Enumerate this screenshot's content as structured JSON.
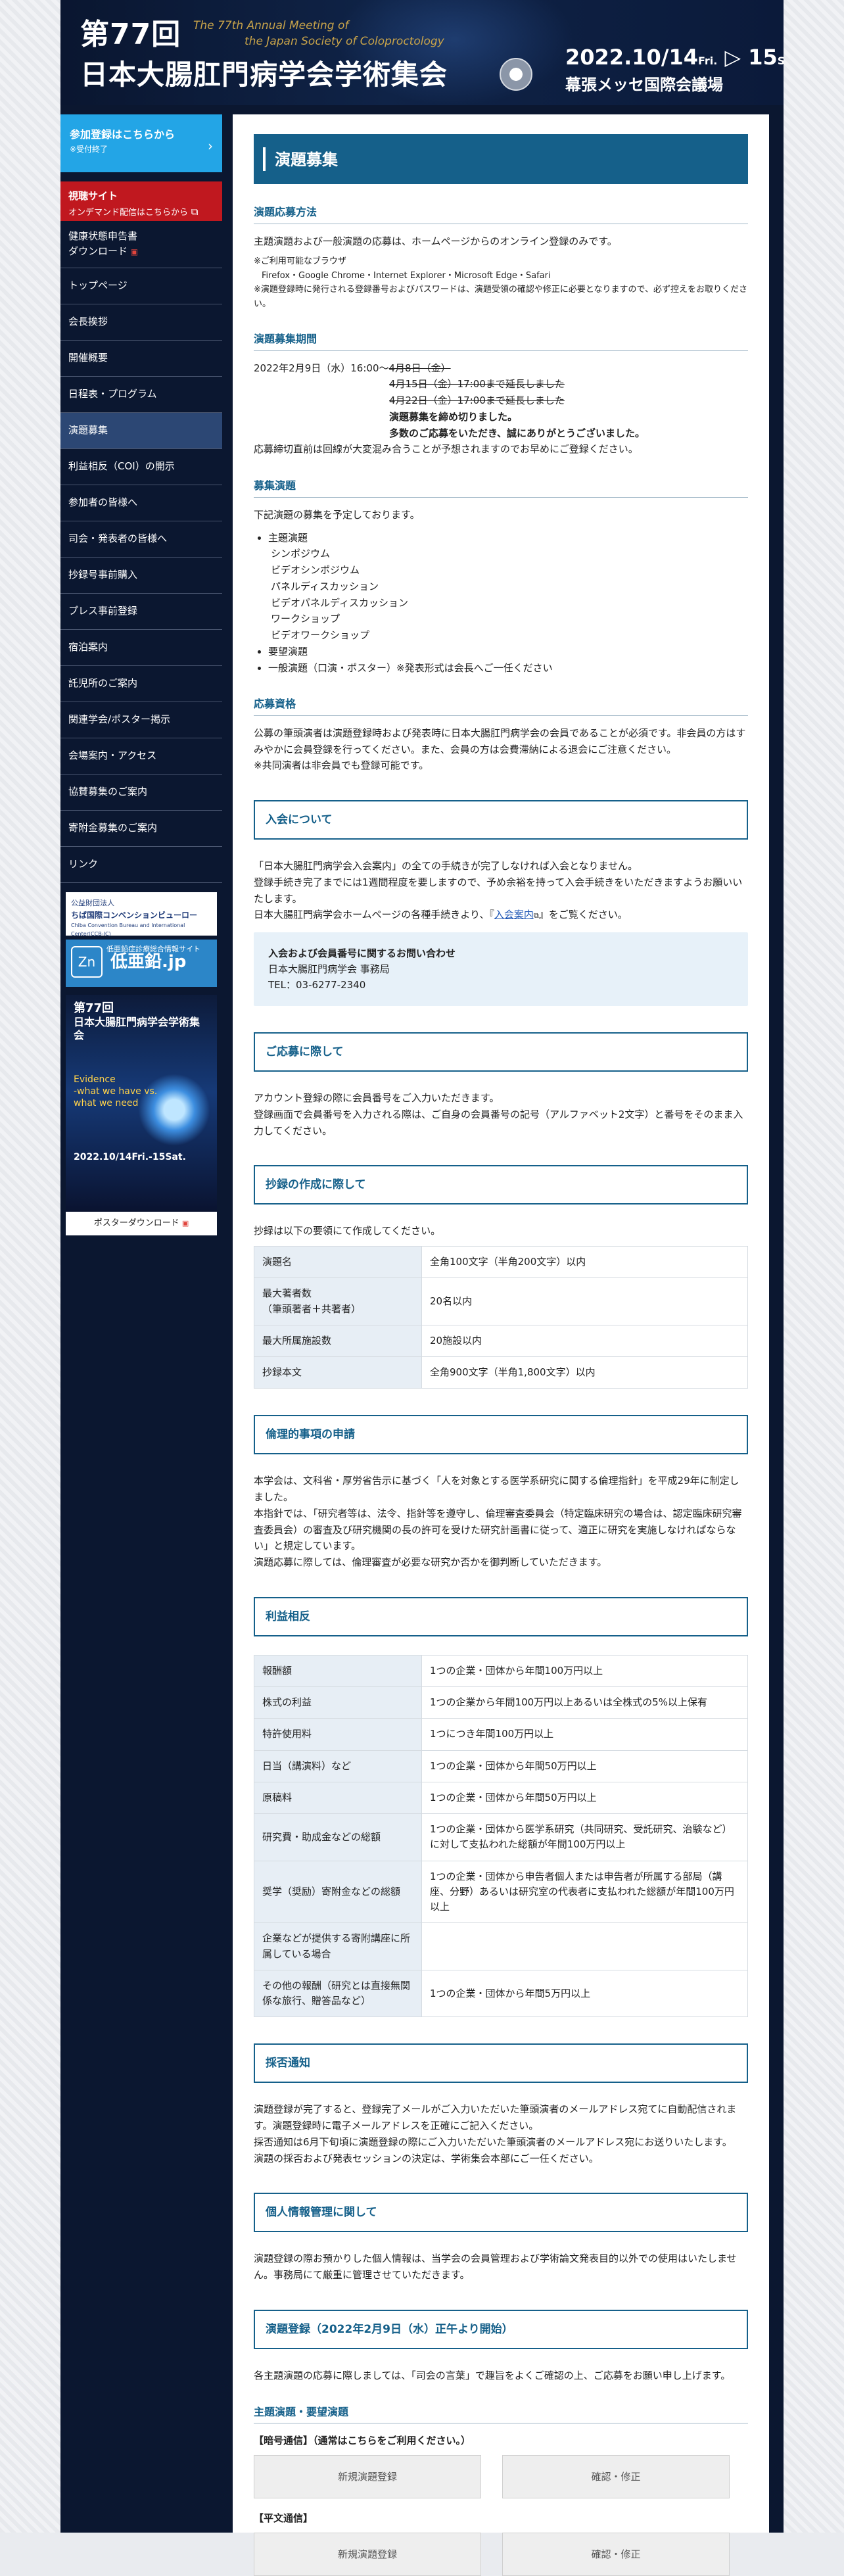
{
  "header": {
    "num": "第77回",
    "title": "日本大腸肛門病学会学術集会",
    "en_line1": "The 77th Annual Meeting of",
    "en_line2": "the Japan Society of Coloproctology",
    "date_main": "2022.10/14",
    "date_fri": "Fri.",
    "date_arrow": "▷",
    "date_15": "15",
    "date_sat": "Sat.",
    "venue": "幕張メッセ国際会議場"
  },
  "sidebar": {
    "register": {
      "title": "参加登録はこちらから",
      "sub": "※受付終了",
      "arrow": "›"
    },
    "live": {
      "title": "視聴サイト",
      "sub": "オンデマンド配信はこちらから",
      "icon": "external-link-icon"
    },
    "items": [
      "健康状態申告書",
      "ダウンロード",
      "トップページ",
      "会長挨拶",
      "開催概要",
      "日程表・プログラム",
      "演題募集",
      "利益相反（COI）の開示",
      "参加者の皆様へ",
      "司会・発表者の皆様へ",
      "抄録号事前購入",
      "プレス事前登録",
      "宿泊案内",
      "託児所のご案内",
      "関連学会/ポスター掲示",
      "会場案内・アクセス",
      "協賛募集のご案内",
      "寄附金募集のご案内",
      "リンク"
    ],
    "banner1": {
      "line1": "公益財団法人",
      "line2": "ちば国際コンベンションビューロー",
      "line3": "Chiba Convention Bureau and International Center(CCB-IC)"
    },
    "banner2": {
      "small": "低亜鉛症診療総合情報サイト",
      "big": "低亜鉛.jp",
      "mark": "Zn"
    },
    "poster": {
      "l1": "第77回",
      "l2": "日本大腸肛門病学会学術集会",
      "l3": "Evidence",
      "l4": "-what we have vs.",
      "l5": "what we need",
      "l6": "2022.10/14Fri.-15Sat."
    },
    "poster_download": "ポスターダウンロード"
  },
  "main": {
    "title": "演題募集",
    "h_apply": "演題応募方法",
    "apply_text": "主題演題および一般演題の応募は、ホームページからのオンライン登録のみです。",
    "browser_head": "※ご利用可能なブラウザ",
    "browser_list": "Firefox・Google Chrome・Internet Explorer・Microsoft Edge・Safari",
    "browser_note": "※演題登録時に発行される登録番号およびパスワードは、演題受領の確認や修正に必要となりますので、必ず控えをお取りください。",
    "h_period": "演題募集期間",
    "period_1": "2022年2月9日（水）16:00～",
    "period_1s": "4月8日（金）",
    "period_2": "4月15日（金）17:00まで延長しました",
    "period_3": "4月22日（金）17:00まで延長しました",
    "period_4": "演題募集を締め切りました。",
    "period_5": "多数のご応募をいただき、誠にありがとうございました。",
    "period_note": "応募締切直前は回線が大変混み合うことが予想されますのでお早めにご登録ください。",
    "h_topics": "募集演題",
    "topics_intro": "下記演題の募集を予定しております。",
    "topic_main": "主題演題",
    "topic_subs": [
      "シンポジウム",
      "ビデオシンポジウム",
      "パネルディスカッション",
      "ビデオパネルディスカッション",
      "ワークショップ",
      "ビデオワークショップ"
    ],
    "topic_req": "要望演題",
    "topic_gen": "一般演題（口演・ポスター）※発表形式は会長へご一任ください",
    "h_qual": "応募資格",
    "qual_text": "公募の筆頭演者は演題登録時および発表時に日本大腸肛門病学会の会員であることが必須です。非会員の方はすみやかに会員登録を行ってください。また、会員の方は会費滞納による退会にご注意ください。",
    "qual_note": "※共同演者は非会員でも登録可能です。",
    "sec_join": "入会について",
    "join_1": "「日本大腸肛門病学会入会案内」の全ての手続きが完了しなければ入会となりません。",
    "join_2": "登録手続き完了までには1週間程度を要しますので、予め余裕を持って入会手続きをいただきますようお願いいたします。",
    "join_3a": "日本大腸肛門病学会ホームページの各種手続きより、『",
    "join_link": "入会案内",
    "join_3b": "』をご覧ください。",
    "contact_h": "入会および会員番号に関するお問い合わせ",
    "contact_org": "日本大腸肛門病学会 事務局",
    "contact_tel": "TEL：03-6277-2340",
    "sec_apply": "ご応募に際して",
    "apply2_1": "アカウント登録の際に会員番号をご入力いただきます。",
    "apply2_2": "登録画面で会員番号を入力される際は、ご自身の会員番号の記号（アルファベット2文字）と番号をそのまま入力してください。",
    "sec_abstract": "抄録の作成に際して",
    "abstract_intro": "抄録は以下の要領にて作成してください。",
    "abstract_rows": [
      {
        "k": "演題名",
        "v": "全角100文字（半角200文字）以内"
      },
      {
        "k": "最大著者数\n（筆頭著者＋共著者）",
        "v": "20名以内"
      },
      {
        "k": "最大所属施設数",
        "v": "20施設以内"
      },
      {
        "k": "抄録本文",
        "v": "全角900文字（半角1,800文字）以内"
      }
    ],
    "sec_ethics": "倫理的事項の申請",
    "ethics_1": "本学会は、文科省・厚労省告示に基づく「人を対象とする医学系研究に関する倫理指針」を平成29年に制定しました。",
    "ethics_2": "本指針では、「研究者等は、法令、指針等を遵守し、倫理審査委員会（特定臨床研究の場合は、認定臨床研究審査委員会）の審査及び研究機関の長の許可を受けた研究計画書に従って、適正に研究を実施しなければならない」と規定しています。",
    "ethics_3": "演題応募に際しては、倫理審査が必要な研究か否かを御判断していただきます。",
    "sec_coi": "利益相反",
    "coi_rows": [
      {
        "k": "報酬額",
        "v": "1つの企業・団体から年間100万円以上"
      },
      {
        "k": "株式の利益",
        "v": "1つの企業から年間100万円以上あるいは全株式の5%以上保有"
      },
      {
        "k": "特許使用料",
        "v": "1つにつき年間100万円以上"
      },
      {
        "k": "日当（講演料）など",
        "v": "1つの企業・団体から年間50万円以上"
      },
      {
        "k": "原稿料",
        "v": "1つの企業・団体から年間50万円以上"
      },
      {
        "k": "研究費・助成金などの総額",
        "v": "1つの企業・団体から医学系研究（共同研究、受託研究、治験など）に対して支払われた総額が年間100万円以上"
      },
      {
        "k": "奨学（奨励）寄附金などの総額",
        "v": "1つの企業・団体から申告者個人または申告者が所属する部局（講座、分野）あるいは研究室の代表者に支払われた総額が年間100万円以上"
      },
      {
        "k": "企業などが提供する寄附講座に所属している場合",
        "v": ""
      },
      {
        "k": "その他の報酬（研究とは直接無関係な旅行、贈答品など）",
        "v": "1つの企業・団体から年間5万円以上"
      }
    ],
    "sec_accept": "採否通知",
    "accept_1": "演題登録が完了すると、登録完了メールがご入力いただいた筆頭演者のメールアドレス宛てに自動配信されます。演題登録時に電子メールアドレスを正確にご記入ください。",
    "accept_2": "採否通知は6月下旬頃に演題登録の際にご入力いただいた筆頭演者のメールアドレス宛にお送りいたします。",
    "accept_3": "演題の採否および発表セッションの決定は、学術集会本部にご一任ください。",
    "sec_privacy": "個人情報管理に関して",
    "privacy_text": "演題登録の際お預かりした個人情報は、当学会の会員管理および学術論文発表目的以外での使用はいたしません。事務局にて厳重に管理させていただきます。",
    "sec_register": "演題登録（2022年2月9日（水）正午より開始）",
    "register_text": "各主題演題の応募に際しましては、「司会の言葉」で趣旨をよくご確認の上、ご応募をお願い申し上げます。",
    "h_main_req": "主題演題・要望演題",
    "label_code": "【暗号通信】（通常はこちらをご利用ください。）",
    "label_plain": "【平文通信】",
    "btn_new": "新規演題登録",
    "btn_confirm": "確認・修正"
  },
  "colors": {
    "primary": "#15608a",
    "register": "#23a5e6",
    "live": "#c0181f",
    "accent_red": "#d11b1b",
    "gold": "#c9a44a"
  }
}
